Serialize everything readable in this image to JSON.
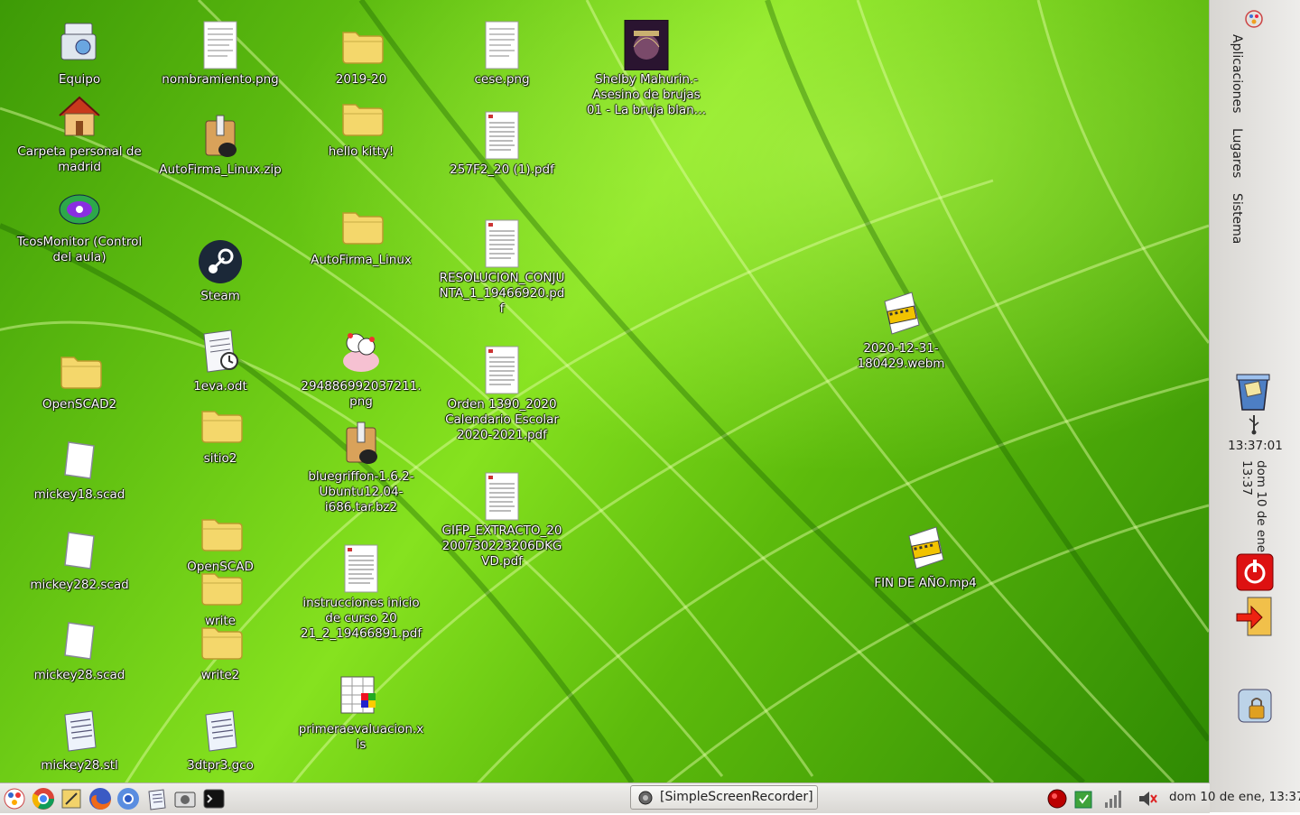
{
  "desktop": {
    "icons": [
      {
        "name": "Equipo",
        "icon": "computer-icon"
      },
      {
        "name": "Carpeta personal de madrid",
        "icon": "home-folder-icon"
      },
      {
        "name": "TcosMonitor (Control del aula)",
        "icon": "tcosmonitor-icon"
      },
      {
        "name": "OpenSCAD2",
        "icon": "folder-icon"
      },
      {
        "name": "mickey18.scad",
        "icon": "scad-file-icon"
      },
      {
        "name": "mickey282.scad",
        "icon": "scad-file-icon"
      },
      {
        "name": "mickey28.scad",
        "icon": "scad-file-icon"
      },
      {
        "name": "mickey28.stl",
        "icon": "text-file-icon"
      },
      {
        "name": "nombramiento.png",
        "icon": "document-thumbnail-icon"
      },
      {
        "name": "AutoFirma_Linux.zip",
        "icon": "archive-icon"
      },
      {
        "name": "Steam",
        "icon": "steam-icon"
      },
      {
        "name": "1eva.odt",
        "icon": "odt-file-icon"
      },
      {
        "name": "sitio2",
        "icon": "folder-icon"
      },
      {
        "name": "OpenSCAD",
        "icon": "folder-icon"
      },
      {
        "name": "write",
        "icon": "folder-icon"
      },
      {
        "name": "write2",
        "icon": "folder-icon"
      },
      {
        "name": "3dtpr3.gco",
        "icon": "text-file-icon"
      },
      {
        "name": "2019-20",
        "icon": "folder-icon"
      },
      {
        "name": "hello kitty!",
        "icon": "folder-icon"
      },
      {
        "name": "AutoFirma_Linux",
        "icon": "folder-icon"
      },
      {
        "name": "294886992037211.png",
        "icon": "image-thumbnail-icon"
      },
      {
        "name": "bluegriffon-1.6.2-Ubuntu12.04-i686.tar.bz2",
        "icon": "archive-icon"
      },
      {
        "name": "instrucciones inicio de curso 20 21_2_19466891.pdf",
        "icon": "pdf-thumbnail-icon"
      },
      {
        "name": "primeraevaluacion.xls",
        "icon": "spreadsheet-icon"
      },
      {
        "name": "cese.png",
        "icon": "document-thumbnail-icon"
      },
      {
        "name": "257F2_20 (1).pdf",
        "icon": "pdf-thumbnail-icon"
      },
      {
        "name": "RESOLUCION_CONJUNTA_1_19466920.pdf",
        "icon": "pdf-thumbnail-icon"
      },
      {
        "name": "Orden 1390_2020 Calendario Escolar 2020-2021.pdf",
        "icon": "pdf-thumbnail-icon"
      },
      {
        "name": "GIFP_EXTRACTO_20200730223206DKGVD.pdf",
        "icon": "pdf-thumbnail-icon"
      },
      {
        "name": "Shelby Mahurin.- Asesino de brujas 01 - La bruja blan…",
        "icon": "book-cover-icon"
      },
      {
        "name": "2020-12-31-180429.webm",
        "icon": "video-file-icon"
      },
      {
        "name": "FIN DE AÑO.mp4",
        "icon": "video-file-icon"
      }
    ]
  },
  "side_panel": {
    "menus": [
      "Aplicaciones",
      "Lugares",
      "Sistema"
    ],
    "clock_time": "13:37:01",
    "clock_date_lines": [
      "dom 10 de ene",
      "13:37"
    ],
    "icons": [
      "gnome-foot-icon",
      "trash-icon",
      "usb-icon",
      "shutdown-icon",
      "logout-icon",
      "lock-screen-icon"
    ]
  },
  "taskbar": {
    "launchers": [
      "main-menu-icon",
      "chrome-icon",
      "text-editor-icon",
      "firefox-icon",
      "chromium-icon",
      "notes-icon",
      "screenshot-icon",
      "terminal-icon"
    ],
    "task_label": "[SimpleScreenRecorder]",
    "tray_icons": [
      "recorder-tray-icon",
      "update-tray-icon",
      "network-signal-icon",
      "volume-icon"
    ],
    "clock": "dom 10 de ene, 13:37"
  },
  "colors": {
    "wallpaper_green": "#6ccf14",
    "folder_yellow": "#f4d76b",
    "panel_bg": "#e6e5e2"
  }
}
